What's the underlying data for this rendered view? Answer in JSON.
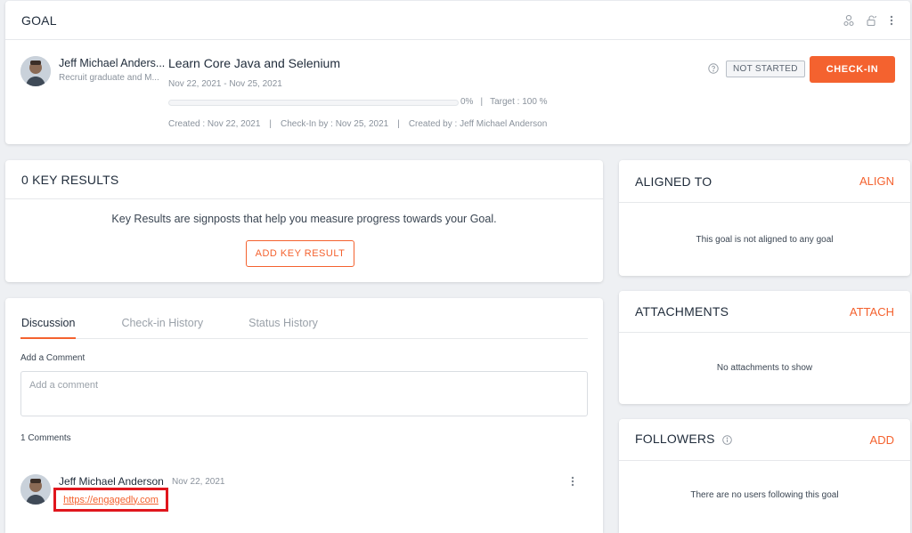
{
  "goal_card": {
    "title": "GOAL",
    "owner_name": "Jeff Michael Anders...",
    "owner_subtitle": "Recruit graduate and M...",
    "goal_title": "Learn Core Java and Selenium",
    "date_range": "Nov 22, 2021 - Nov 25, 2021",
    "progress_percent": 0,
    "progress_label": "0%",
    "separator": "|",
    "target_label": "Target : 100 %",
    "created_label": "Created : Nov 22, 2021",
    "checkin_by_label": "Check-In by : Nov 25, 2021",
    "created_by_label": "Created by : Jeff Michael Anderson",
    "status_badge": "NOT STARTED",
    "checkin_button": "CHECK-IN",
    "icons": [
      "users-icon",
      "lock-icon",
      "more-vertical-icon",
      "help-icon"
    ]
  },
  "key_results": {
    "title": "0 KEY RESULTS",
    "description": "Key Results are signposts that help you measure progress towards your Goal.",
    "add_button": "ADD KEY RESULT"
  },
  "discussion": {
    "tabs": [
      {
        "label": "Discussion",
        "active": true
      },
      {
        "label": "Check-in History",
        "active": false
      },
      {
        "label": "Status History",
        "active": false
      }
    ],
    "add_comment_label": "Add a Comment",
    "comment_placeholder": "Add a comment",
    "comments_count": "1 Comments",
    "comments": [
      {
        "author": "Jeff Michael Anderson",
        "date": "Nov 22, 2021",
        "link_text": "https://engagedly.com"
      }
    ]
  },
  "aligned_to": {
    "title": "ALIGNED TO",
    "action": "ALIGN",
    "empty_text": "This goal is not aligned to any goal"
  },
  "attachments": {
    "title": "ATTACHMENTS",
    "action": "ATTACH",
    "empty_text": "No attachments to show"
  },
  "followers": {
    "title": "FOLLOWERS",
    "action": "ADD",
    "empty_text": "There are no users following this goal"
  },
  "colors": {
    "accent": "#f4622f",
    "highlight_border": "#e0161d",
    "background": "#eef0f3"
  }
}
